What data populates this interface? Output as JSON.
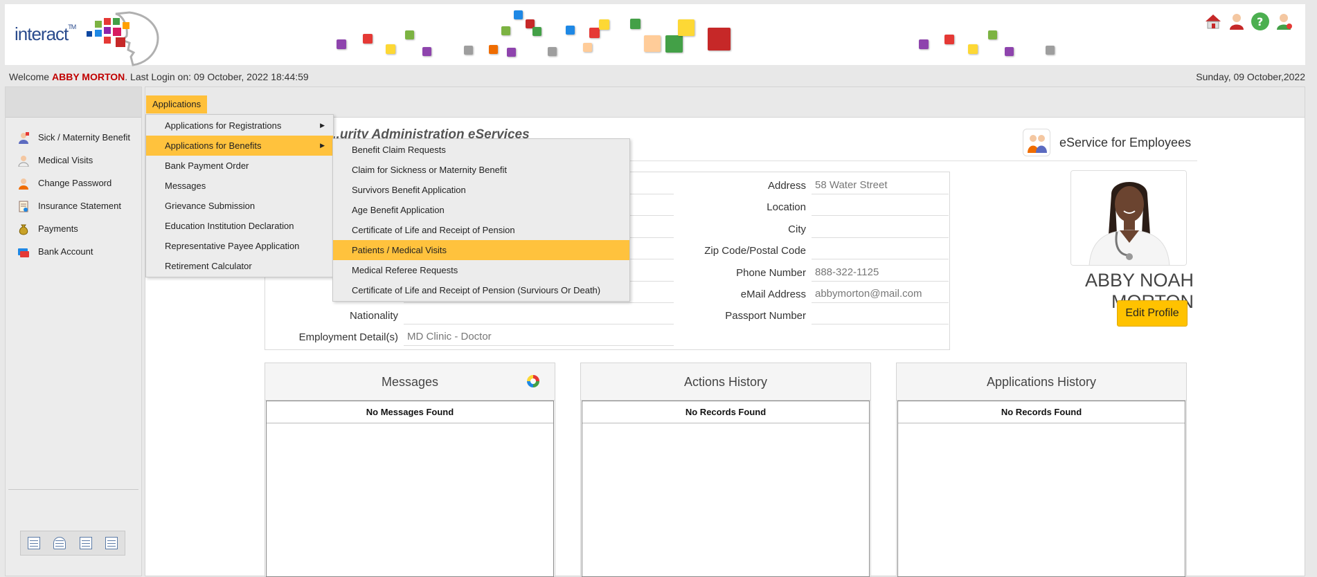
{
  "header": {
    "logo_text": "interact",
    "logo_tm": "TM",
    "icons": [
      "home-icon",
      "user-profile-icon",
      "help-icon",
      "logout-icon"
    ]
  },
  "welcome": {
    "prefix": "Welcome",
    "user": "ABBY MORTON",
    "last_login": ". Last Login on: 09 October, 2022 18:44:59",
    "date": "Sunday, 09 October,2022"
  },
  "sidebar": {
    "items": [
      {
        "label": "Sick / Maternity Benefit",
        "icon": "sick-benefit-icon"
      },
      {
        "label": "Medical Visits",
        "icon": "doctor-icon"
      },
      {
        "label": "Change Password",
        "icon": "user-key-icon"
      },
      {
        "label": "Insurance Statement",
        "icon": "statement-icon"
      },
      {
        "label": "Payments",
        "icon": "money-bag-icon"
      },
      {
        "label": "Bank Account",
        "icon": "bank-card-icon"
      }
    ]
  },
  "tab": {
    "label": "Applications"
  },
  "page": {
    "title": "...urity Administration eServices",
    "eservice_label": "eService for Employees"
  },
  "profile": {
    "fields_left": [
      {
        "label": "",
        "value": ""
      },
      {
        "label": "",
        "value": ""
      },
      {
        "label": "",
        "value": ""
      },
      {
        "label": "",
        "value": ""
      },
      {
        "label": "",
        "value": ""
      },
      {
        "label": "",
        "value": ""
      },
      {
        "label": "Nationality",
        "value": ""
      },
      {
        "label": "Employment Detail(s)",
        "value": "MD Clinic - Doctor"
      }
    ],
    "fields_right": [
      {
        "label": "Address",
        "value": "58 Water Street"
      },
      {
        "label": "Location",
        "value": ""
      },
      {
        "label": "City",
        "value": ""
      },
      {
        "label": "Zip Code/Postal Code",
        "value": ""
      },
      {
        "label": "Phone Number",
        "value": "888-322-1125"
      },
      {
        "label": "eMail Address",
        "value": "abbymorton@mail.com"
      },
      {
        "label": "Passport Number",
        "value": ""
      }
    ],
    "name": "ABBY NOAH MORTON",
    "edit_label": "Edit Profile"
  },
  "panels": [
    {
      "title": "Messages",
      "empty": "No Messages Found"
    },
    {
      "title": "Actions History",
      "empty": "No Records Found"
    },
    {
      "title": "Applications History",
      "empty": "No Records Found"
    }
  ],
  "menu": {
    "items": [
      {
        "label": "Applications for Registrations",
        "submenu": true,
        "arrow": "▶"
      },
      {
        "label": "Applications for Benefits",
        "submenu": true,
        "arrow": "▶",
        "highlighted": true
      },
      {
        "label": "Bank Payment Order"
      },
      {
        "label": "Messages"
      },
      {
        "label": "Grievance Submission"
      },
      {
        "label": "Education Institution Declaration"
      },
      {
        "label": "Representative Payee Application"
      },
      {
        "label": "Retirement Calculator"
      }
    ],
    "submenu": [
      {
        "label": "Benefit Claim Requests"
      },
      {
        "label": "Claim for Sickness or Maternity Benefit"
      },
      {
        "label": "Survivors Benefit Application"
      },
      {
        "label": "Age Benefit Application"
      },
      {
        "label": "Certificate of Life and Receipt of Pension"
      },
      {
        "label": "Patients / Medical Visits",
        "highlighted": true
      },
      {
        "label": "Medical Referee Requests"
      },
      {
        "label": "Certificate of Life and Receipt of Pension (Surviours Or Death)"
      }
    ]
  },
  "colors": {
    "accent": "#ffc23d",
    "username": "#c00000",
    "logo_blue": "#2a4b8d"
  }
}
